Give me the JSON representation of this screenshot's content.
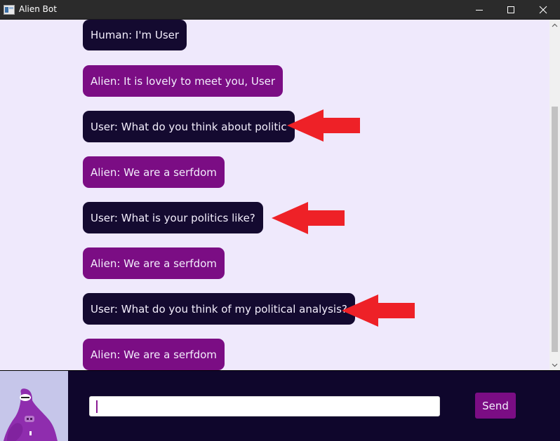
{
  "window": {
    "title": "Alien Bot",
    "minimize_icon": "minimize-icon",
    "maximize_icon": "maximize-icon",
    "close_icon": "close-icon"
  },
  "chat": {
    "messages": [
      {
        "sender": "human",
        "text": "Human: I'm User"
      },
      {
        "sender": "alien",
        "text": "Alien: It is lovely to meet you, User"
      },
      {
        "sender": "user",
        "text": "User: What do you think about politic"
      },
      {
        "sender": "alien",
        "text": "Alien: We are a serfdom"
      },
      {
        "sender": "user",
        "text": "User: What is your politics like?"
      },
      {
        "sender": "alien",
        "text": "Alien: We are a serfdom"
      },
      {
        "sender": "user",
        "text": "User: What do you think of my political analysis?"
      },
      {
        "sender": "alien",
        "text": "Alien: We are a serfdom"
      }
    ],
    "annotation_icon": "red-arrow-left-icon"
  },
  "composer": {
    "input_value": "",
    "send_label": "Send",
    "avatar_icon": "purple-alien-avatar"
  },
  "colors": {
    "chat_background": "#efe9fc",
    "user_bubble": "#140a30",
    "alien_bubble": "#7b0d84",
    "bubble_text": "#f3eefc",
    "bottom_bar": "#0f062c",
    "send_button": "#7b0d84",
    "annotation_arrow": "#ee2127"
  }
}
